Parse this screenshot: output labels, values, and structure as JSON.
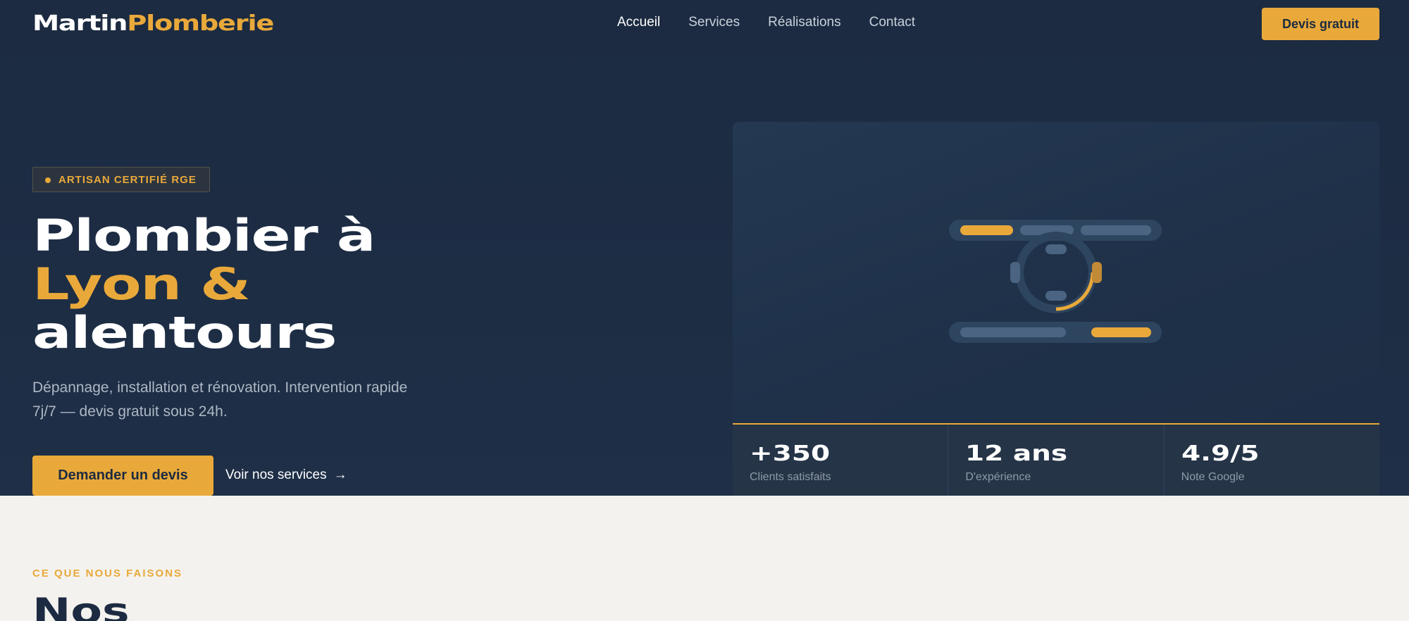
{
  "header": {
    "logo_part1": "Martin",
    "logo_part2": "Plomberie",
    "nav": [
      "Accueil",
      "Services",
      "Réalisations",
      "Contact"
    ],
    "active_nav": "Accueil",
    "cta_label": "Devis gratuit"
  },
  "hero": {
    "badge": "ARTISAN CERTIFIÉ RGE",
    "title_line1": "Plombier à",
    "title_line2": "Lyon &",
    "title_line3": "alentours",
    "lead": "Dépannage, installation et rénovation. Intervention rapide 7j/7 — devis gratuit sous 24h.",
    "primary_button": "Demander un devis",
    "secondary_link": "Voir nos services",
    "secondary_arrow": "→",
    "illustration_icon": "support-headset-icon"
  },
  "stats": [
    {
      "value": "+350",
      "label": "Clients satisfaits"
    },
    {
      "value": "12 ans",
      "label": "D'expérience"
    },
    {
      "value": "4.9/5",
      "label": "Note Google"
    }
  ],
  "services_section": {
    "eyebrow": "CE QUE NOUS FAISONS",
    "title": "Nos"
  },
  "colors": {
    "navy": "#1c2b41",
    "accent": "#e9a93a",
    "light_bg": "#f4f2ee"
  }
}
